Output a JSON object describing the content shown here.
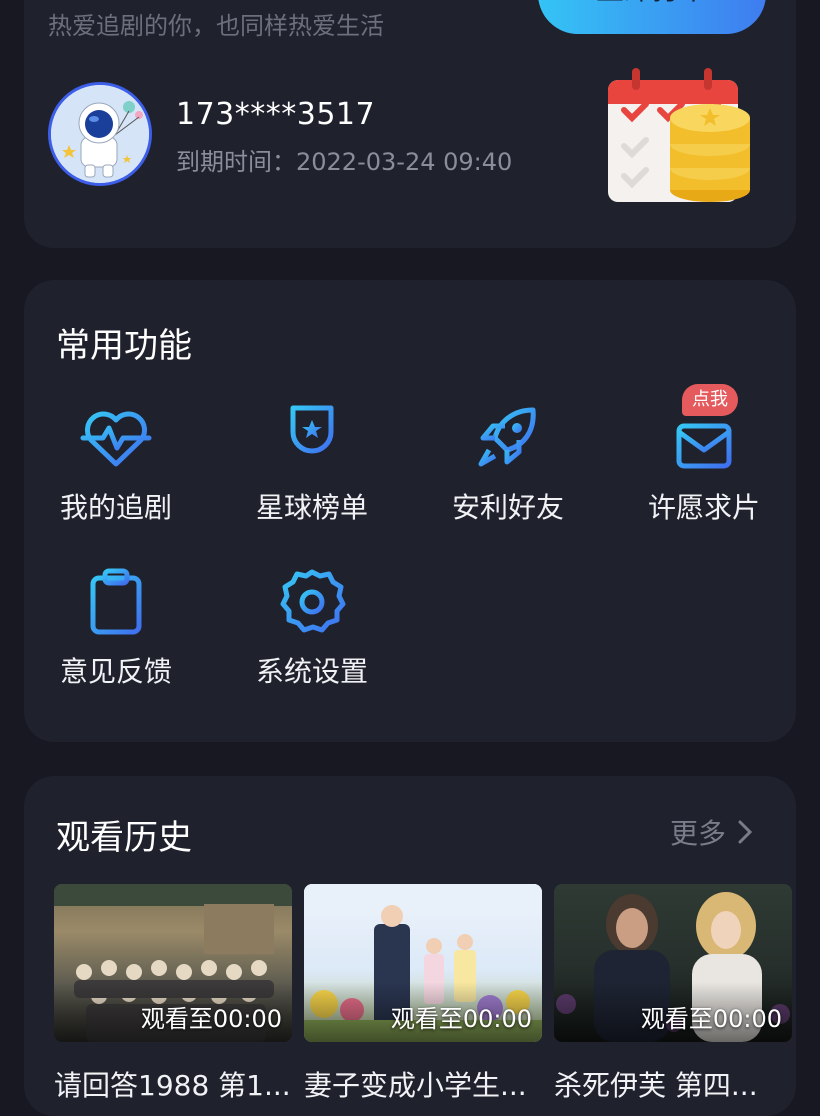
{
  "profile": {
    "tagline": "热爱追剧的你，也同样热爱生活",
    "checkin_label": "立即打卡",
    "phone": "173****3517",
    "expiry_label": "到期时间：",
    "expiry_value": "2022-03-24  09:40"
  },
  "functions": {
    "title": "常用功能",
    "badge": "点我",
    "items": [
      {
        "label": "我的追剧",
        "icon": "heart-pulse-icon"
      },
      {
        "label": "星球榜单",
        "icon": "trophy-cup-icon"
      },
      {
        "label": "安利好友",
        "icon": "rocket-icon"
      },
      {
        "label": "许愿求片",
        "icon": "envelope-icon"
      },
      {
        "label": "意见反馈",
        "icon": "clipboard-icon"
      },
      {
        "label": "系统设置",
        "icon": "gear-icon"
      }
    ]
  },
  "history": {
    "title": "观看历史",
    "more_label": "更多",
    "items": [
      {
        "progress": "观看至00:00",
        "title": "请回答1988 第1..."
      },
      {
        "progress": "观看至00:00",
        "title": "妻子变成小学生..."
      },
      {
        "progress": "观看至00:00",
        "title": "杀死伊芙 第四..."
      }
    ]
  },
  "colors": {
    "accent": "#3f7cf0",
    "accent_light": "#34c4f5",
    "background": "#171821",
    "card": "#1f212c",
    "badge": "#e55a5c"
  }
}
